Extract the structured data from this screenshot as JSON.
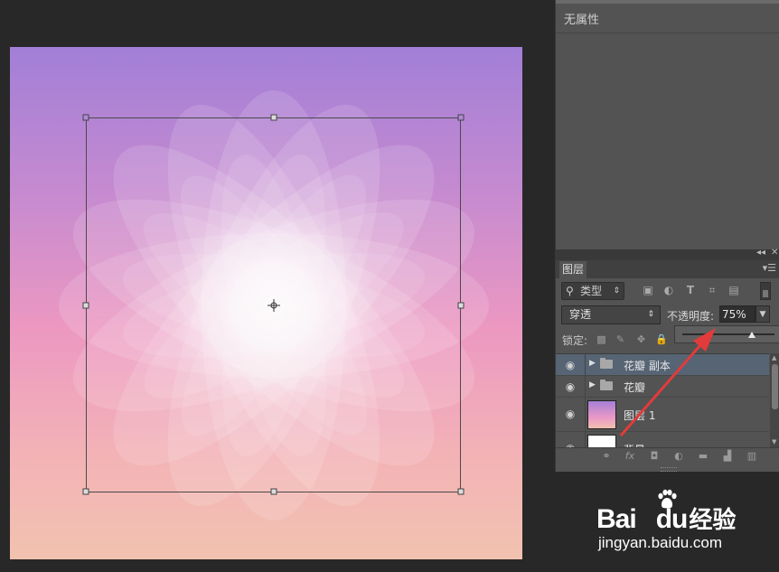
{
  "properties_panel": {
    "title": "无属性"
  },
  "layers_panel": {
    "controls": [
      "◂◂",
      "✕"
    ],
    "tab_label": "图层",
    "panel_menu_icon": "panel-menu-icon",
    "filter": {
      "kind_label": "类型",
      "search_icon": "search-icon",
      "arrow": "⇕"
    },
    "filter_icons": [
      "image-filter-icon",
      "adjustment-filter-icon",
      "type-filter-icon",
      "shape-filter-icon",
      "smart-object-filter-icon"
    ],
    "blend_mode": "穿透",
    "opacity_label": "不透明度:",
    "opacity_value": "75%",
    "opacity_fraction": 0.75,
    "lock_label": "锁定:",
    "lock_icons": [
      "lock-transparent-icon",
      "lock-paint-icon",
      "lock-position-icon",
      "lock-all-icon"
    ],
    "layers": [
      {
        "name": "花瓣 副本",
        "type": "group",
        "selected": true
      },
      {
        "name": "花瓣",
        "type": "group",
        "selected": false
      },
      {
        "name": "图层 1",
        "type": "layer",
        "selected": false
      },
      {
        "name": "背景",
        "type": "background",
        "selected": false
      }
    ],
    "footer_icons": [
      "link-layers-icon",
      "fx-icon",
      "add-mask-icon",
      "adjustment-layer-icon",
      "new-group-icon",
      "new-layer-icon",
      "delete-layer-icon"
    ]
  },
  "symbols": {
    "eye": "👁",
    "expand": "▶",
    "dropdown": "▾",
    "fx": "fx",
    "trash": "🗑"
  },
  "watermark": {
    "brand": "Bai",
    "brand_du": "du",
    "brand_cn": "经验",
    "url": "jingyan.baidu.com"
  }
}
